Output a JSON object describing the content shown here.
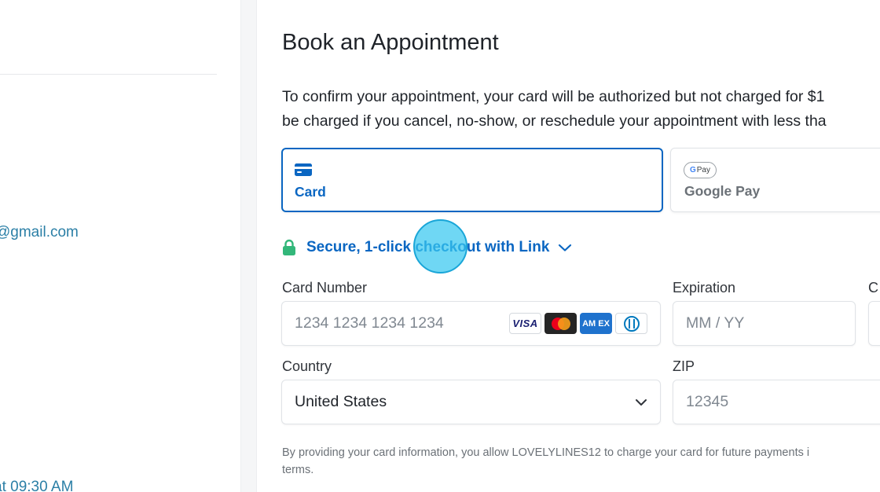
{
  "left_panel": {
    "email_fragment": "@gmail.com",
    "time_fragment": "at 09:30 AM"
  },
  "main": {
    "title": "Book an Appointment",
    "intro_line1": "To confirm your appointment, your card will be authorized but not charged for $1",
    "intro_line2": "be charged if you cancel, no-show, or reschedule your appointment with less tha"
  },
  "payment_methods": {
    "card_label": "Card",
    "google_pay_label": "Google Pay",
    "google_pay_badge": "Pay",
    "google_pay_badge_g": "G",
    "selected": "Card"
  },
  "link": {
    "text": "Secure, 1-click checkout with Link"
  },
  "form": {
    "card_number_label": "Card Number",
    "card_number_placeholder": "1234 1234 1234 1234",
    "expiration_label": "Expiration",
    "expiration_placeholder": "MM / YY",
    "cvc_label_fragment": "C",
    "country_label": "Country",
    "country_value": "United States",
    "zip_label": "ZIP",
    "zip_placeholder": "12345",
    "card_brands": [
      "VISA",
      "Mastercard",
      "AMEX",
      "Diners Club"
    ],
    "visa_text": "VISA",
    "amex_text": "AM EX"
  },
  "disclaimer": {
    "line1": "By providing your card information, you allow LOVELYLINES12 to charge your card for future payments i",
    "line2": "terms."
  },
  "colors": {
    "accent": "#0a66c2",
    "link_green": "#33b77a",
    "left_link": "#2b7fa6",
    "click_indicator": "#38c8f0"
  }
}
